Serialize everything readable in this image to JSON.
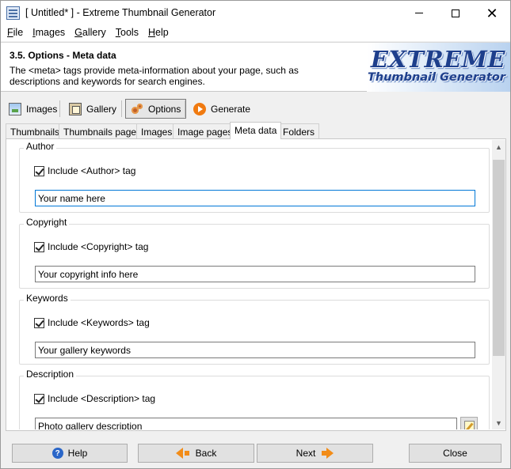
{
  "window": {
    "title": "[ Untitled* ] - Extreme Thumbnail Generator"
  },
  "menu": [
    {
      "label": "File",
      "accel": "F",
      "rest": "ile"
    },
    {
      "label": "Images",
      "accel": "I",
      "rest": "mages"
    },
    {
      "label": "Gallery",
      "accel": "G",
      "rest": "allery"
    },
    {
      "label": "Tools",
      "accel": "T",
      "rest": "ools"
    },
    {
      "label": "Help",
      "accel": "H",
      "rest": "elp"
    }
  ],
  "header": {
    "title": "3.5. Options - Meta data",
    "description": "The <meta> tags provide meta-information about your page, such as descriptions and keywords for search engines.",
    "logo_line1": "EXTREME",
    "logo_line2": "Thumbnail Generator"
  },
  "steps": [
    {
      "label": "Images",
      "icon": "images-icon"
    },
    {
      "label": "Gallery",
      "icon": "gallery-icon"
    },
    {
      "label": "Options",
      "icon": "options-icon",
      "active": true
    },
    {
      "label": "Generate",
      "icon": "generate-icon"
    }
  ],
  "tabs": [
    {
      "label": "Thumbnails"
    },
    {
      "label": "Thumbnails pages"
    },
    {
      "label": "Images"
    },
    {
      "label": "Image pages"
    },
    {
      "label": "Meta data",
      "active": true
    },
    {
      "label": "Folders"
    }
  ],
  "groups": {
    "author": {
      "legend": "Author",
      "checkbox_label": "Include <Author> tag",
      "checked": true,
      "value": "Your name here"
    },
    "copyright": {
      "legend": "Copyright",
      "checkbox_label": "Include <Copyright> tag",
      "checked": true,
      "value": "Your copyright info here"
    },
    "keywords": {
      "legend": "Keywords",
      "checkbox_label": "Include <Keywords> tag",
      "checked": true,
      "value": "Your gallery keywords"
    },
    "description": {
      "legend": "Description",
      "checkbox_label": "Include <Description> tag",
      "checked": true,
      "value": "Photo gallery description"
    }
  },
  "buttons": {
    "help": "Help",
    "back": "Back",
    "next": "Next",
    "close": "Close"
  },
  "colors": {
    "accent": "#0078d7",
    "arrow": "#f28c18",
    "logo_text": "#1e3f8c"
  }
}
